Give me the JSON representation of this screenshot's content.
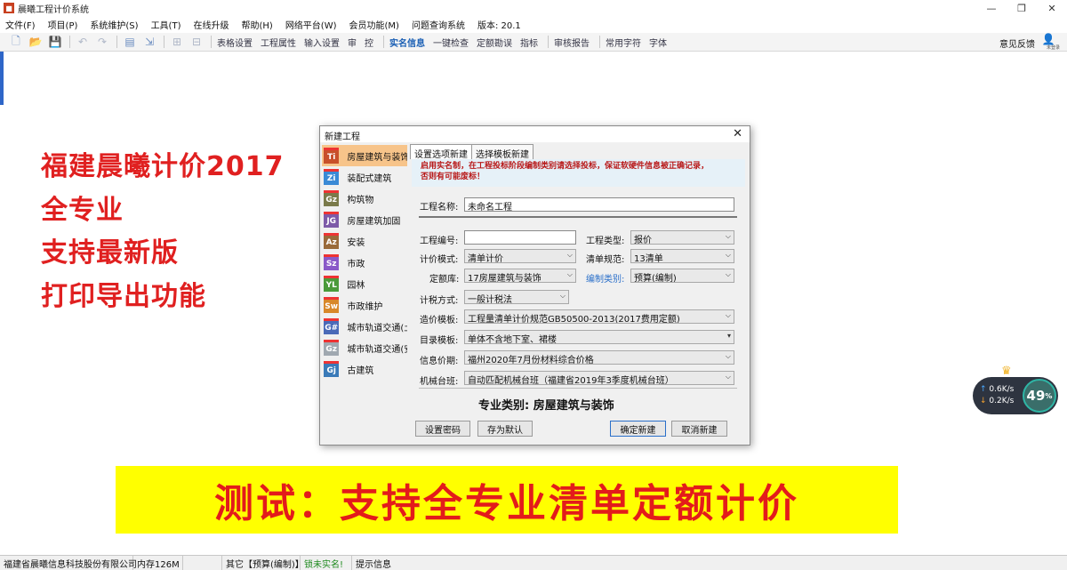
{
  "window": {
    "title": "晨曦工程计价系统",
    "controls": [
      "minimize-icon",
      "maximize-icon",
      "close-icon"
    ]
  },
  "menu": [
    "文件(F)",
    "项目(P)",
    "系统维护(S)",
    "工具(T)",
    "在线升级",
    "帮助(H)",
    "网络平台(W)",
    "会员功能(M)",
    "问题查询系统",
    "版本: 20.1"
  ],
  "toolbar": {
    "texts": [
      "表格设置",
      "工程属性",
      "输入设置",
      "审",
      "控",
      "实名信息",
      "一键检查",
      "定额勘误",
      "指标",
      "审核报告",
      "常用字符",
      "字体"
    ],
    "feedback": "意见反馈",
    "user_label": "未登录"
  },
  "promo": {
    "line1": "福建晨曦计价2017",
    "line2": "全专业",
    "line3": "支持最新版",
    "line4": "打印导出功能",
    "banner": "测试：支持全专业清单定额计价",
    "text_color": "#e02020",
    "banner_bg": "#ffff00"
  },
  "dialog": {
    "title": "新建工程",
    "categories": [
      {
        "abbr": "Ti",
        "label": "房屋建筑与装饰",
        "color": "#c8502a"
      },
      {
        "abbr": "Zi",
        "label": "装配式建筑",
        "color": "#3a8ad6"
      },
      {
        "abbr": "Gz",
        "label": "构筑物",
        "color": "#7a7a4a"
      },
      {
        "abbr": "JG",
        "label": "房屋建筑加固",
        "color": "#7d5aa8"
      },
      {
        "abbr": "Az",
        "label": "安装",
        "color": "#9a6a3a"
      },
      {
        "abbr": "Sz",
        "label": "市政",
        "color": "#8a5ac8"
      },
      {
        "abbr": "YL",
        "label": "园林",
        "color": "#4a9a3a"
      },
      {
        "abbr": "Sw",
        "label": "市政维护",
        "color": "#d8882a"
      },
      {
        "abbr": "G#",
        "label": "城市轨道交通(土",
        "color": "#4a6ab8"
      },
      {
        "abbr": "Gz",
        "label": "城市轨道交通(安",
        "color": "#a0a8b0"
      },
      {
        "abbr": "Gj",
        "label": "古建筑",
        "color": "#3a7ab8"
      }
    ],
    "tabs": [
      "设置选项新建",
      "选择模板新建"
    ],
    "notice_line1": "启用实名制，在工程投标阶段编制类别请选择投标，保证软硬件信息被正确记录，",
    "notice_line2": "否则有可能废标！",
    "fields": {
      "name_label": "工程名称:",
      "name_value": "未命名工程",
      "code_label": "工程编号:",
      "code_value": "",
      "type_label": "工程类型:",
      "type_value": "报价",
      "pricing_label": "计价模式:",
      "pricing_value": "清单计价",
      "spec_label": "清单规范:",
      "spec_value": "13清单",
      "quota_label": "定额库:",
      "quota_value": "17房屋建筑与装饰",
      "compile_label": "编制类别:",
      "compile_value": "预算(编制)",
      "tax_label": "计税方式:",
      "tax_value": "一般计税法",
      "cost_label": "造价模板:",
      "cost_value": "工程量清单计价规范GB50500-2013(2017费用定额)",
      "dir_label": "目录模板:",
      "dir_value": "单体不含地下室、裙楼",
      "price_label": "信息价期:",
      "price_value": "福州2020年7月份材料综合价格",
      "machine_label": "机械台班:",
      "machine_value": "自动匹配机械台班（福建省2019年3季度机械台班）"
    },
    "major": "专业类别: 房屋建筑与装饰",
    "buttons": {
      "password": "设置密码",
      "save_default": "存为默认",
      "confirm": "确定新建",
      "cancel": "取消新建"
    }
  },
  "speed": {
    "up": "0.6K/s",
    "down": "0.2K/s",
    "percent": "49",
    "percent_sign": "%"
  },
  "status": {
    "company": "福建省晨曦信息科技股份有限公司",
    "memory": "内存126M",
    "blank": "",
    "other": "其它【预算(编制)】",
    "realname": "锁未实名!",
    "tip": "提示信息"
  }
}
